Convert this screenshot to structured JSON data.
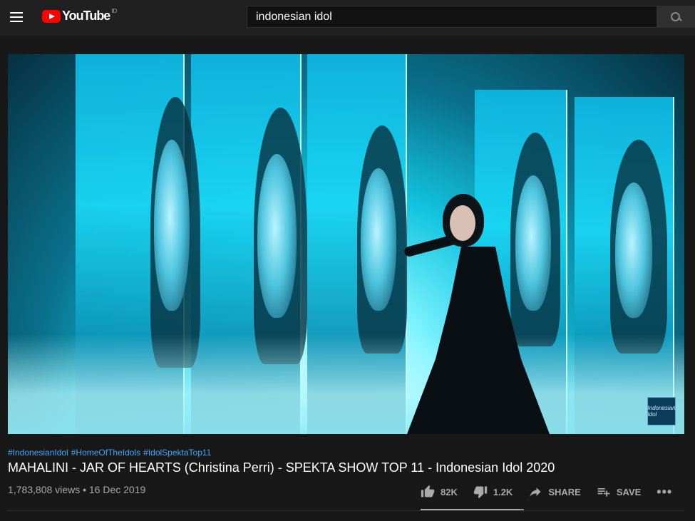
{
  "header": {
    "logo_text": "YouTube",
    "country_code": "ID",
    "search_value": "indonesian idol"
  },
  "video": {
    "watermark_text": "Indonesian Idol",
    "hashtags": [
      "#IndonesianIdol",
      "#HomeOfTheIdols",
      "#IdolSpektaTop11"
    ],
    "title": "MAHALINI - JAR OF HEARTS (Christina Perri) - SPEKTA SHOW TOP 11 - Indonesian Idol 2020",
    "views": "1,783,808 views",
    "separator": "•",
    "date": "16 Dec 2019"
  },
  "actions": {
    "like_count": "82K",
    "dislike_count": "1.2K",
    "share_label": "SHARE",
    "save_label": "SAVE",
    "more_label": "•••"
  },
  "icons": {
    "menu": "hamburger-menu-icon",
    "search": "search-icon",
    "like": "thumbs-up-icon",
    "dislike": "thumbs-down-icon",
    "share": "share-arrow-icon",
    "save": "playlist-add-icon",
    "more": "more-horizontal-icon"
  },
  "colors": {
    "accent_red": "#ff0000",
    "link_blue": "#3ea6ff",
    "background": "#181818",
    "topbar": "#202020"
  }
}
